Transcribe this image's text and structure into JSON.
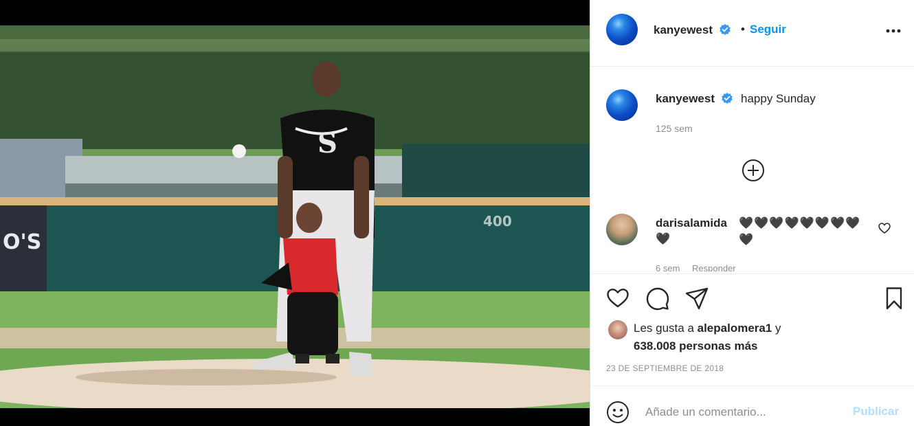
{
  "post": {
    "author": "kanyewest",
    "verified_icon": "verified-badge-icon",
    "follow_separator": "•",
    "follow_label": "Seguir",
    "more_icon": "more-options-icon",
    "photo_description_icon": "post-photo"
  },
  "caption": {
    "author": "kanyewest",
    "text": "happy Sunday",
    "time": "125 sem"
  },
  "load_more_icon": "plus-circle-icon",
  "comments": [
    {
      "author": "darisalamida",
      "text_line1": "🖤🖤🖤🖤🖤🖤🖤🖤🖤",
      "text_line2": "🖤",
      "time": "6 sem",
      "reply": "Responder"
    }
  ],
  "actions": {
    "like_icon": "heart-icon",
    "comment_icon": "comment-icon",
    "share_icon": "send-icon",
    "save_icon": "bookmark-icon"
  },
  "likes": {
    "prefix": "Les gusta a ",
    "user": "alepalomera1",
    "mid": " y",
    "count": "638.008 personas más"
  },
  "date": "23 DE SEPTIEMBRE DE 2018",
  "composer": {
    "placeholder": "Añade un comentario...",
    "publish_label": "Publicar"
  },
  "colors": {
    "link_blue": "#0095f6",
    "publish_disabled": "#b2dffc",
    "muted": "#8e8e8e"
  }
}
